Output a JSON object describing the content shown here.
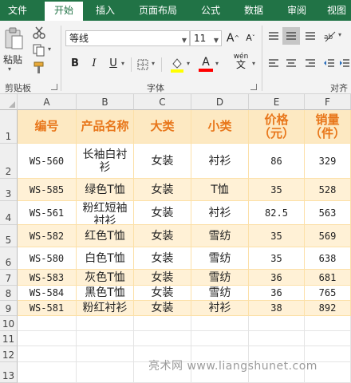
{
  "tabs": [
    {
      "label": "文件",
      "active": false
    },
    {
      "label": "开始",
      "active": true
    },
    {
      "label": "插入",
      "active": false
    },
    {
      "label": "页面布局",
      "active": false
    },
    {
      "label": "公式",
      "active": false
    },
    {
      "label": "数据",
      "active": false
    },
    {
      "label": "审阅",
      "active": false
    },
    {
      "label": "视图",
      "active": false
    }
  ],
  "ribbon": {
    "clipboard": {
      "paste_label": "粘贴",
      "group_label": "剪贴板"
    },
    "font": {
      "font_name": "等线",
      "font_size": "11",
      "bold": "B",
      "italic": "I",
      "underline": "U",
      "grow_font": "A",
      "shrink_font": "A",
      "font_color_letter": "A",
      "phonetic_label": "wén",
      "group_label": "字体"
    },
    "alignment": {
      "group_label": "对齐"
    },
    "colors": {
      "highlight": "#ffff00",
      "font_color": "#ff0000",
      "accent": "#217346"
    }
  },
  "columns": [
    "A",
    "B",
    "C",
    "D",
    "E",
    "F"
  ],
  "header_row": [
    "编号",
    "产品名称",
    "大类",
    "小类",
    "价格（元）",
    "销量（件）"
  ],
  "rows": [
    [
      "WS-560",
      "长袖白衬衫",
      "女装",
      "衬衫",
      "86",
      "329"
    ],
    [
      "WS-585",
      "绿色T恤",
      "女装",
      "T恤",
      "35",
      "528"
    ],
    [
      "WS-561",
      "粉红短袖衬衫",
      "女装",
      "衬衫",
      "82.5",
      "563"
    ],
    [
      "WS-582",
      "红色T恤",
      "女装",
      "雪纺",
      "35",
      "569"
    ],
    [
      "WS-580",
      "白色T恤",
      "女装",
      "雪纺",
      "35",
      "638"
    ],
    [
      "WS-583",
      "灰色T恤",
      "女装",
      "雪纺",
      "36",
      "681"
    ],
    [
      "WS-584",
      "黑色T恤",
      "女装",
      "雪纺",
      "36",
      "765"
    ],
    [
      "WS-581",
      "粉红衬衫",
      "女装",
      "衬衫",
      "38",
      "892"
    ]
  ],
  "row_numbers": [
    "1",
    "2",
    "3",
    "4",
    "5",
    "6",
    "7",
    "8",
    "9",
    "10",
    "11",
    "12",
    "13"
  ],
  "watermark": "亮术网 www.liangshunet.com",
  "table_colors": {
    "header_fill": "#fde9c2",
    "header_text": "#e8761a",
    "band_fill": "#fff1d6",
    "border": "#fce0a8"
  }
}
